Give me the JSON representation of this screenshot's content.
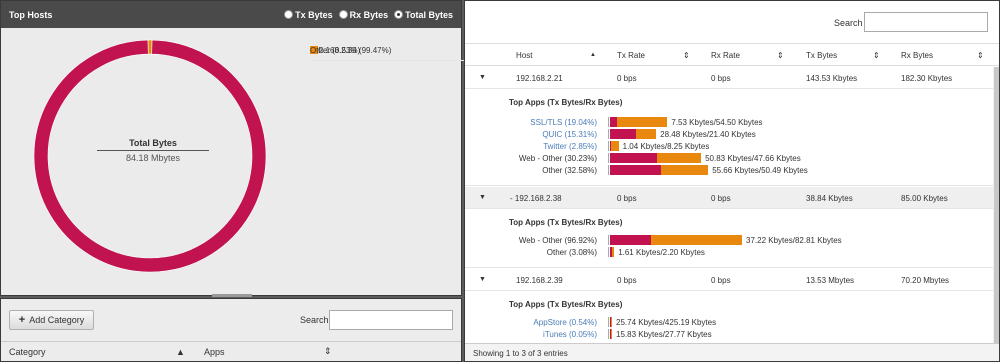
{
  "top_hosts": {
    "title": "Top Hosts",
    "radios": [
      {
        "label": "Tx Bytes",
        "checked": false
      },
      {
        "label": "Rx Bytes",
        "checked": false
      },
      {
        "label": "Total Bytes",
        "checked": true
      }
    ],
    "center_label": "Total Bytes",
    "center_value": "84.18 Mbytes",
    "legend": [
      {
        "label": "192.168.2.39 (99.47%)",
        "color": "#c0134f"
      },
      {
        "label": "Other (0.53%)",
        "color": "#e8880f"
      }
    ],
    "chart_data": {
      "type": "pie",
      "categories": [
        "192.168.2.39",
        "Other"
      ],
      "values": [
        99.47,
        0.53
      ],
      "colors": [
        "#c0134f",
        "#e8880f"
      ]
    }
  },
  "category_panel": {
    "add_button": "Add Category",
    "search_label": "Search",
    "columns": [
      "Category",
      "Apps"
    ]
  },
  "hosts_table": {
    "search_label": "Search",
    "columns": [
      "Host",
      "Tx Rate",
      "Rx Rate",
      "Tx Bytes",
      "Rx Bytes"
    ],
    "detail_title": "Top Apps (Tx Bytes/Rx Bytes)",
    "rows": [
      {
        "host": "192.168.2.21",
        "tx_rate": "0 bps",
        "rx_rate": "0 bps",
        "tx_bytes": "143.53 Kbytes",
        "rx_bytes": "182.30 Kbytes"
      },
      {
        "host": "- 192.168.2.38",
        "tx_rate": "0 bps",
        "rx_rate": "0 bps",
        "tx_bytes": "38.84 Kbytes",
        "rx_bytes": "85.00 Kbytes"
      },
      {
        "host": "192.168.2.39",
        "tx_rate": "0 bps",
        "rx_rate": "0 bps",
        "tx_bytes": "13.53 Mbytes",
        "rx_bytes": "70.20 Mbytes"
      }
    ],
    "apps_1": [
      {
        "name": "SSL/TLS (19.04%)",
        "link": true,
        "tx": 7.53,
        "rx": 54.5,
        "text": "7.53 Kbytes/54.50 Kbytes"
      },
      {
        "name": "QUIC (15.31%)",
        "link": true,
        "tx": 28.48,
        "rx": 21.4,
        "text": "28.48 Kbytes/21.40 Kbytes"
      },
      {
        "name": "Twitter (2.85%)",
        "link": true,
        "tx": 1.04,
        "rx": 8.25,
        "text": "1.04 Kbytes/8.25 Kbytes"
      },
      {
        "name": "Web - Other (30.23%)",
        "link": false,
        "tx": 50.83,
        "rx": 47.66,
        "text": "50.83 Kbytes/47.66 Kbytes"
      },
      {
        "name": "Other (32.58%)",
        "link": false,
        "tx": 55.66,
        "rx": 50.49,
        "text": "55.66 Kbytes/50.49 Kbytes"
      }
    ],
    "apps_2": [
      {
        "name": "Web - Other (96.92%)",
        "link": false,
        "tx": 37.22,
        "rx": 82.81,
        "text": "37.22 Kbytes/82.81 Kbytes"
      },
      {
        "name": "Other (3.08%)",
        "link": false,
        "tx": 1.61,
        "rx": 2.2,
        "text": "1.61 Kbytes/2.20 Kbytes"
      }
    ],
    "apps_3": [
      {
        "name": "AppStore (0.54%)",
        "link": true,
        "tx": 25.74,
        "rx": 425.19,
        "text": "25.74 Kbytes/425.19 Kbytes"
      },
      {
        "name": "iTunes (0.05%)",
        "link": true,
        "tx": 15.83,
        "rx": 27.77,
        "text": "15.83 Kbytes/27.77 Kbytes"
      }
    ],
    "footer": "Showing 1 to 3 of 3 entries"
  }
}
